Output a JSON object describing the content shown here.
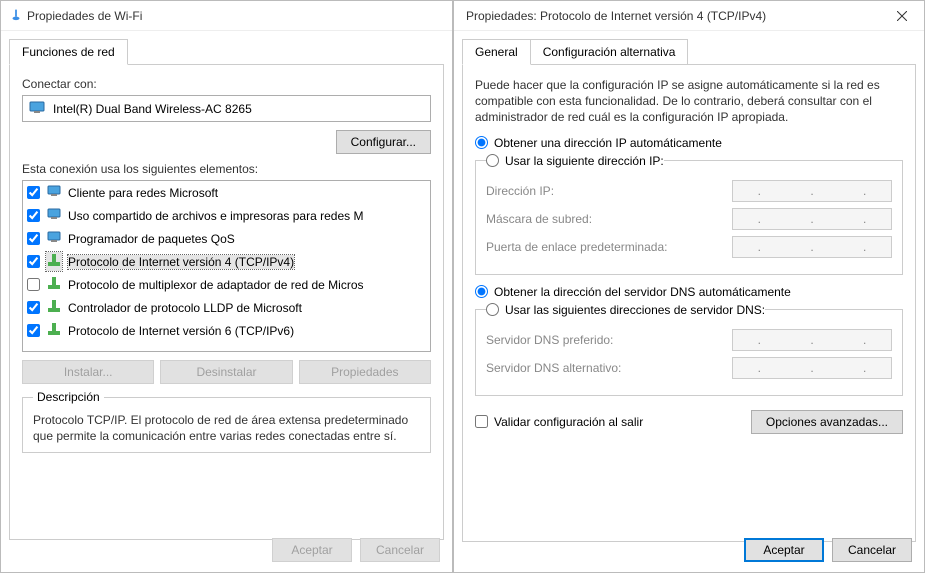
{
  "window1": {
    "title": "Propiedades de Wi-Fi",
    "tab": "Funciones de red",
    "connect_label": "Conectar con:",
    "adapter": "Intel(R) Dual Band Wireless-AC 8265",
    "configure_btn": "Configurar...",
    "items_label": "Esta conexión usa los siguientes elementos:",
    "items": [
      {
        "checked": true,
        "icon": "client",
        "label": "Cliente para redes Microsoft"
      },
      {
        "checked": true,
        "icon": "client",
        "label": "Uso compartido de archivos e impresoras para redes M"
      },
      {
        "checked": true,
        "icon": "client",
        "label": "Programador de paquetes QoS"
      },
      {
        "checked": true,
        "icon": "proto",
        "label": "Protocolo de Internet versión 4 (TCP/IPv4)",
        "selected": true
      },
      {
        "checked": false,
        "icon": "proto",
        "label": "Protocolo de multiplexor de adaptador de red de Micros"
      },
      {
        "checked": true,
        "icon": "proto",
        "label": "Controlador de protocolo LLDP de Microsoft"
      },
      {
        "checked": true,
        "icon": "proto",
        "label": "Protocolo de Internet versión 6 (TCP/IPv6)"
      }
    ],
    "install_btn": "Instalar...",
    "uninstall_btn": "Desinstalar",
    "properties_btn": "Propiedades",
    "desc_legend": "Descripción",
    "desc_text": "Protocolo TCP/IP. El protocolo de red de área extensa predeterminado que permite la comunicación entre varias redes conectadas entre sí.",
    "ok_btn": "Aceptar",
    "cancel_btn": "Cancelar"
  },
  "window2": {
    "title": "Propiedades: Protocolo de Internet versión 4 (TCP/IPv4)",
    "tab_general": "General",
    "tab_alt": "Configuración alternativa",
    "intro": "Puede hacer que la configuración IP se asigne automáticamente si la red es compatible con esta funcionalidad. De lo contrario, deberá consultar con el administrador de red cuál es la configuración IP apropiada.",
    "radio_ip_auto": "Obtener una dirección IP automáticamente",
    "radio_ip_manual": "Usar la siguiente dirección IP:",
    "ip_label": "Dirección IP:",
    "mask_label": "Máscara de subred:",
    "gateway_label": "Puerta de enlace predeterminada:",
    "radio_dns_auto": "Obtener la dirección del servidor DNS automáticamente",
    "radio_dns_manual": "Usar las siguientes direcciones de servidor DNS:",
    "dns1_label": "Servidor DNS preferido:",
    "dns2_label": "Servidor DNS alternativo:",
    "validate_label": "Validar configuración al salir",
    "advanced_btn": "Opciones avanzadas...",
    "ok_btn": "Aceptar",
    "cancel_btn": "Cancelar"
  }
}
